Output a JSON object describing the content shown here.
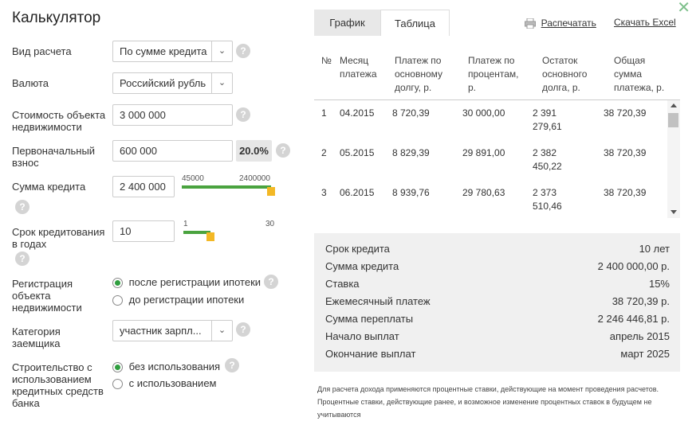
{
  "title": "Калькулятор",
  "close_glyph": "✕",
  "form": {
    "calc_type_label": "Вид расчета",
    "calc_type_value": "По сумме кредита",
    "currency_label": "Валюта",
    "currency_value": "Российский рубль",
    "property_cost_label": "Стоимость объекта недвижимости",
    "property_cost_value": "3 000 000",
    "down_payment_label": "Первоначальный взнос",
    "down_payment_value": "600 000",
    "down_payment_percent": "20.0%",
    "loan_amount_label": "Сумма кредита",
    "loan_amount_value": "2 400 000",
    "loan_slider_min": "45000",
    "loan_slider_max": "2400000",
    "loan_slider_fraction": 1.0,
    "term_label": "Срок кредитования в годах",
    "term_value": "10",
    "term_slider_min": "1",
    "term_slider_max": "30",
    "term_slider_fraction": 0.31,
    "registration_label": "Регистрация объекта недвижимости",
    "registration_options": [
      "после регистрации ипотеки",
      "до регистрации ипотеки"
    ],
    "registration_selected": 0,
    "borrower_category_label": "Категория заемщика",
    "borrower_category_value": "участник зарпл...",
    "construction_label": "Строительство с использованием кредитных средств банка",
    "construction_options": [
      "без использования",
      "с использованием"
    ],
    "construction_selected": 0,
    "help_glyph": "?",
    "arrow_glyph": "⌄"
  },
  "tabs": [
    "График",
    "Таблица"
  ],
  "active_tab": 1,
  "actions": {
    "print_label": "Распечатать",
    "excel_label": "Скачать Excel"
  },
  "table": {
    "headers": [
      "№",
      "Месяц платежа",
      "Платеж по основному долгу, р.",
      "Платеж по процентам, р.",
      "Остаток основного долга, р.",
      "Общая сумма платежа, р."
    ],
    "rows": [
      [
        "1",
        "04.2015",
        "8 720,39",
        "30 000,00",
        "2 391 279,61",
        "38 720,39"
      ],
      [
        "2",
        "05.2015",
        "8 829,39",
        "29 891,00",
        "2 382 450,22",
        "38 720,39"
      ],
      [
        "3",
        "06.2015",
        "8 939,76",
        "29 780,63",
        "2 373 510,46",
        "38 720,39"
      ]
    ]
  },
  "summary": [
    {
      "label": "Срок кредита",
      "value": "10 лет"
    },
    {
      "label": "Сумма кредита",
      "value": "2 400 000,00 р."
    },
    {
      "label": "Ставка",
      "value": "15%"
    },
    {
      "label": "Ежемесячный платеж",
      "value": "38 720,39 р."
    },
    {
      "label": "Сумма переплаты",
      "value": "2 246 446,81 р."
    },
    {
      "label": "Начало выплат",
      "value": "апрель 2015"
    },
    {
      "label": "Окончание выплат",
      "value": "март 2025"
    }
  ],
  "note": "Для расчета дохода применяются процентные ставки, действующие на момент проведения расчетов. Процентные ставки, действующие ранее, и возможное изменение процентных ставок в будущем не учитываются",
  "colors": {
    "accent_green": "#2f9e3f",
    "slider_green": "#4aa33f",
    "handle_yellow": "#f3b825"
  }
}
